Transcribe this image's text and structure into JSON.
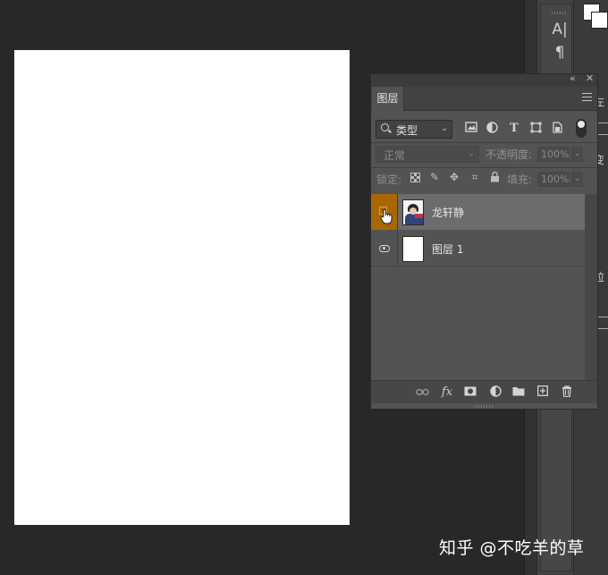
{
  "canvas": {
    "background": "#ffffff"
  },
  "right_strip": {
    "icons": [
      "A|",
      "¶"
    ]
  },
  "right_fragments": {
    "frag1": "左",
    "frag2": "变",
    "frag3": "粒",
    "frag4": "过"
  },
  "layers_panel": {
    "tab_label": "图层",
    "filter": {
      "label": "类型"
    },
    "blend_mode": "正常",
    "opacity_label": "不透明度:",
    "opacity_value": "100%",
    "lock_label": "锁定:",
    "fill_label": "填充:",
    "fill_value": "100%",
    "layers": [
      {
        "name": "龙轩静",
        "active": true,
        "visibility_highlight": "#a96700"
      },
      {
        "name": "图层 1",
        "active": false
      }
    ],
    "footer_icons": [
      "link-icon",
      "fx-icon",
      "mask-icon",
      "adjustment-icon",
      "folder-icon",
      "new-layer-icon",
      "trash-icon"
    ]
  },
  "watermark": "知乎 @不吃羊的草"
}
